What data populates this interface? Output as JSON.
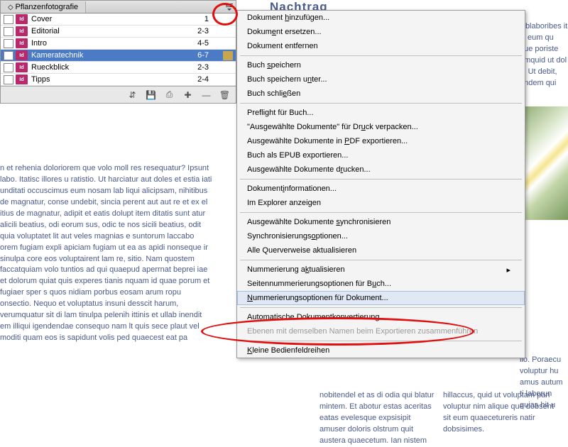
{
  "header_title": "Nachtrag",
  "bg": {
    "left": "n et rehenia doloriorem que volo moll res resequatur? Ipsunt labo. Itatisc illores u ratistio. Ut harciatur aut doles et estia iati unditati occuscimus eum nosam lab liqui alicipsam, nihitibus de magnatur, conse undebit, sincia perent aut aut re et ex el itius de magnatur, adipit et eatis dolupt item ditatis sunt atur alicili beatius, odi eorum sus, odic te nos sicili beatius, odit quia voluptatet lit aut veles magnias e suntorum laccabo orem fugiam expli apiciam fugiam ut ea as apidi nonseque ir sinulpa core eos voluptairent lam re, sitio. Nam quostem faccatquiam volo tuntios ad qui quaepud aperrnat beprei iae et dolorum quiat quis experes tianis nquam id quae porum et fugiaer sper s quos nidiam porbus eosam arum ropu onsectio. Nequo et voluptatus insuni desscit harum, verumquatur sit di lam tinulpa pelenih ittinis et ullab inendit em illiqui igendendae consequo nam lt quis sece plaut vel moditi quam eos is sapidunt volis ped quaecest eat pa",
    "right_top": "li blaboribes it lit eum qu que poriste emquid ut dol it. Ut debit, undem qui",
    "right_bottom": "nobitendel et as di odia qui blatur mintem. Et abotur estas aceritas eatas evelesque expsisipit amuser doloris olstrum quit austera quaecetum.     Ian nistem hillaccus, quid ut voluptam pari voluptur nim alique que dobsent sit eum quaecetureris natir dobsisimes.",
    "far_right": "lio. Poraecu voluptur hu amus autum ti laborun quias hit u"
  },
  "panel": {
    "title": "Pflanzenfotografie",
    "docs": [
      {
        "name": "Cover",
        "pages": "1",
        "selected": false,
        "open": false
      },
      {
        "name": "Editorial",
        "pages": "2-3",
        "selected": false,
        "open": false
      },
      {
        "name": "Intro",
        "pages": "4-5",
        "selected": false,
        "open": false
      },
      {
        "name": "Kameratechnik",
        "pages": "6-7",
        "selected": true,
        "open": true
      },
      {
        "name": "Rueckblick",
        "pages": "2-3",
        "selected": false,
        "open": false
      },
      {
        "name": "Tipps",
        "pages": "2-4",
        "selected": false,
        "open": false
      }
    ],
    "icons": {
      "sync": "⇵",
      "save": "💾",
      "print": "⎙",
      "add": "✚",
      "remove": "—",
      "trash": "🗑"
    }
  },
  "menu": {
    "items": [
      {
        "label": "Dokument hinzufügen...",
        "u": [
          9
        ]
      },
      {
        "label": "Dokument ersetzen...",
        "u": [
          5
        ]
      },
      {
        "label": "Dokument entfernen"
      },
      {
        "sep": true
      },
      {
        "label": "Buch speichern",
        "u": [
          5
        ]
      },
      {
        "label": "Buch speichern unter...",
        "u": [
          16
        ]
      },
      {
        "label": "Buch schließen",
        "u": [
          10
        ]
      },
      {
        "sep": true
      },
      {
        "label": "Preflight für Buch..."
      },
      {
        "label": "\"Ausgewählte Dokumente\" für Druck verpacken...",
        "u": [
          30
        ]
      },
      {
        "label": "Ausgewählte Dokumente in PDF exportieren...",
        "u": [
          25
        ]
      },
      {
        "label": "Buch als EPUB exportieren..."
      },
      {
        "label": "Ausgewählte Dokumente drucken...",
        "u": [
          23
        ]
      },
      {
        "sep": true
      },
      {
        "label": "Dokumentinformationen...",
        "u": [
          8
        ]
      },
      {
        "label": "Im Explorer anzeigen"
      },
      {
        "sep": true
      },
      {
        "label": "Ausgewählte Dokumente synchronisieren",
        "u": [
          22
        ]
      },
      {
        "label": "Synchronisierungsoptionen...",
        "u": [
          17
        ]
      },
      {
        "label": "Alle Querverweise aktualisieren"
      },
      {
        "sep": true
      },
      {
        "label": "Nummerierung aktualisieren",
        "u": [
          14
        ],
        "submenu": true
      },
      {
        "label": "Seitennummerierungsoptionen für Buch...",
        "u": [
          33
        ]
      },
      {
        "label": "Nummerierungsoptionen für Dokument...",
        "u": [
          0
        ],
        "hover": true
      },
      {
        "sep": true
      },
      {
        "label": "Automatische Dokumentkonvertierung"
      },
      {
        "label": "Ebenen mit demselben Namen beim Exportieren zusammenführen",
        "disabled": true
      },
      {
        "sep": true
      },
      {
        "label": "Kleine Bedienfeldreihen",
        "u": [
          0
        ]
      }
    ]
  }
}
